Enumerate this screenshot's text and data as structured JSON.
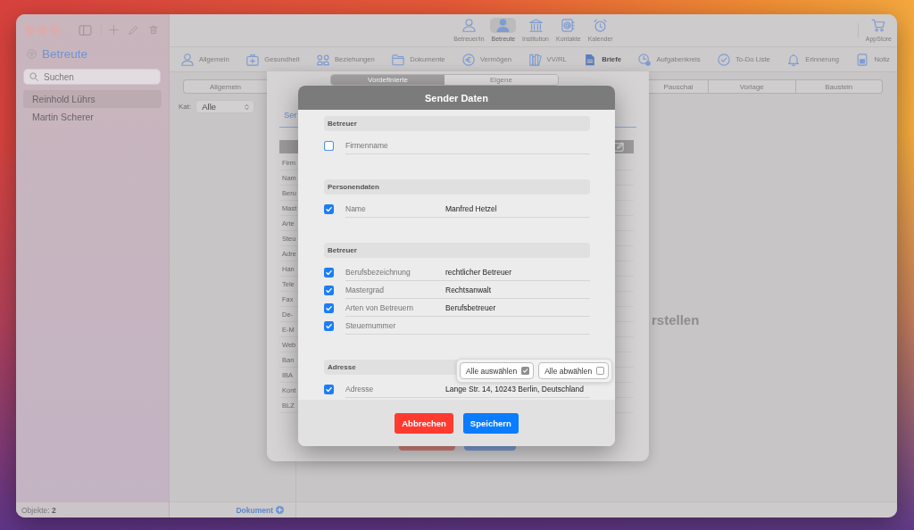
{
  "sidebar": {
    "title": "Betreute",
    "search": {
      "placeholder": "Suchen"
    },
    "items": [
      {
        "label": "Reinhold Lührs",
        "selected": true
      },
      {
        "label": "Martin Scherer",
        "selected": false
      }
    ],
    "status": "Objekte: **2**"
  },
  "toolbar": {
    "items": [
      {
        "label": "Betreuer/in",
        "selected": false
      },
      {
        "label": "Betreute",
        "selected": true
      },
      {
        "label": "Institution",
        "selected": false
      },
      {
        "label": "Kontakte",
        "selected": false
      },
      {
        "label": "Kalender",
        "selected": false
      }
    ],
    "store_button": "AppStore"
  },
  "nav": {
    "items": [
      {
        "label": "Allgemein",
        "selected": false
      },
      {
        "label": "Gesundheit",
        "selected": false
      },
      {
        "label": "Beziehungen",
        "selected": false
      },
      {
        "label": "Dokumente",
        "selected": false
      },
      {
        "label": "Vermögen",
        "selected": false
      },
      {
        "label": "VV/RL",
        "selected": false
      },
      {
        "label": "Briefe",
        "selected": true
      },
      {
        "label": "Aufgabenkreis",
        "selected": false
      },
      {
        "label": "To-Do Liste",
        "selected": false
      },
      {
        "label": "Erinnerung",
        "selected": false
      },
      {
        "label": "Notiz",
        "selected": false
      }
    ]
  },
  "list_panel": {
    "segments": [
      {
        "label": "Allgemein",
        "selected": false
      }
    ],
    "filter": {
      "label": "Kat:",
      "value": "Alle"
    },
    "add_button": "Dokument"
  },
  "document_panel": {
    "segments": [
      {
        "label": "Pauschal",
        "selected": false
      },
      {
        "label": "Vorlage",
        "selected": false
      },
      {
        "label": "Baustein",
        "selected": false
      }
    ],
    "empty_text": "rstellen"
  },
  "sheet": {
    "segments": [
      {
        "label": "Vordefinierte",
        "selected": true
      },
      {
        "label": "Eigene",
        "selected": false
      }
    ],
    "tabs": [
      {
        "label": "Ser",
        "selected": true
      }
    ],
    "rows": [
      "Firm",
      "Nam",
      "Beru",
      "Mast",
      "Arte",
      "Steu",
      "Adre",
      "Han",
      "Tele",
      "Fax",
      "De-",
      "E-M",
      "Web",
      "Ban",
      "IBA",
      "Kont",
      "BLZ"
    ],
    "buttons": [
      {
        "kind": "cancel"
      },
      {
        "kind": "save"
      }
    ]
  },
  "dialog": {
    "title": "Sender Daten",
    "sections": [
      {
        "title": "Betreuer",
        "fields": [
          {
            "label": "Firmenname",
            "checked": false
          }
        ]
      },
      {
        "title": "Personendaten",
        "fields": [
          {
            "label": "Name",
            "value": "Manfred Hetzel",
            "checked": true
          }
        ]
      },
      {
        "title": "Betreuer",
        "fields": [
          {
            "label": "Berufsbezeichnung",
            "value": "rechtlicher Betreuer",
            "checked": true
          },
          {
            "label": "Mastergrad",
            "value": "Rechtsanwalt",
            "checked": true
          },
          {
            "label": "Arten von Betreuern",
            "value": "Berufsbetreuer",
            "checked": true
          },
          {
            "label": "Steuernummer",
            "checked": true
          }
        ]
      },
      {
        "title": "Adresse",
        "fields": [
          {
            "label": "Adresse",
            "value": "Lange Str. 14, 10243 Berlin, Deutschland",
            "checked": true
          }
        ]
      }
    ],
    "select_popup": {
      "buttons": [
        {
          "label": "Alle auswählen",
          "checked": true
        },
        {
          "label": "Alle abwählen",
          "checked": false
        }
      ]
    },
    "buttons": [
      {
        "label": "Abbrechen",
        "kind": "cancel"
      },
      {
        "label": "Speichern",
        "kind": "save"
      }
    ]
  }
}
